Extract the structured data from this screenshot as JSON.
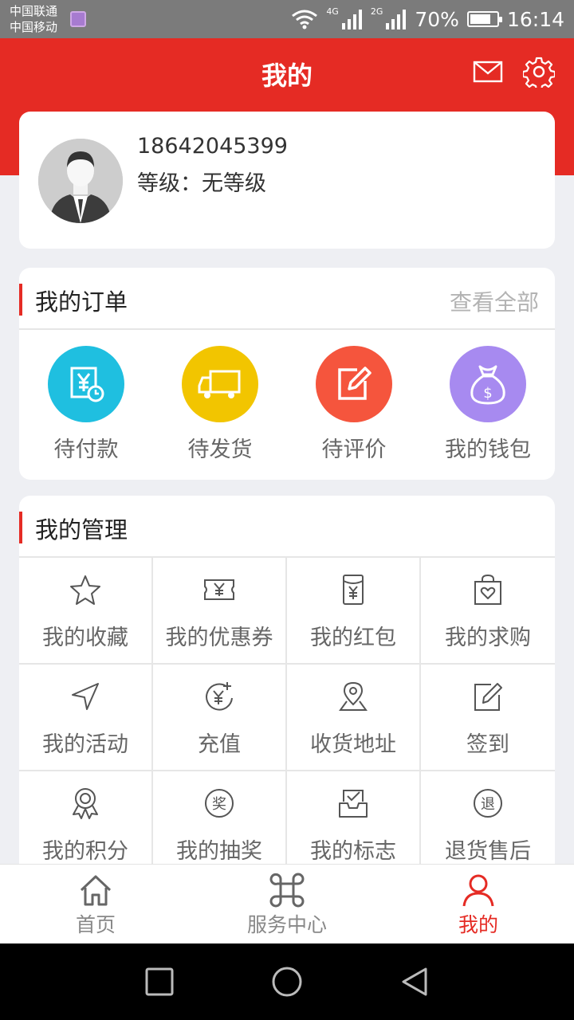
{
  "status_bar": {
    "carrier1": "中国联通",
    "carrier2": "中国移动",
    "net1": "4G",
    "net2": "2G",
    "battery": "70%",
    "time": "16:14"
  },
  "header": {
    "title": "我的"
  },
  "profile": {
    "phone": "18642045399",
    "level_label": "等级：",
    "level_value": "无等级"
  },
  "orders": {
    "title": "我的订单",
    "see_all": "查看全部",
    "items": [
      {
        "label": "待付款",
        "icon": "yen-clock-icon",
        "color": "#1fbfe0"
      },
      {
        "label": "待发货",
        "icon": "truck-icon",
        "color": "#f2c500"
      },
      {
        "label": "待评价",
        "icon": "edit-icon",
        "color": "#f5553d"
      },
      {
        "label": "我的钱包",
        "icon": "money-bag-icon",
        "color": "#a78af0"
      }
    ]
  },
  "manage": {
    "title": "我的管理",
    "items": [
      {
        "label": "我的收藏",
        "icon": "star-icon"
      },
      {
        "label": "我的优惠券",
        "icon": "coupon-icon"
      },
      {
        "label": "我的红包",
        "icon": "red-envelope-icon"
      },
      {
        "label": "我的求购",
        "icon": "shopping-bag-icon"
      },
      {
        "label": "我的活动",
        "icon": "navigation-icon"
      },
      {
        "label": "充值",
        "icon": "recharge-icon"
      },
      {
        "label": "收货地址",
        "icon": "location-icon"
      },
      {
        "label": "签到",
        "icon": "check-in-icon"
      },
      {
        "label": "我的积分",
        "icon": "medal-icon"
      },
      {
        "label": "我的抽奖",
        "icon": "prize-icon"
      },
      {
        "label": "我的标志",
        "icon": "inbox-check-icon"
      },
      {
        "label": "退货售后",
        "icon": "return-icon"
      }
    ]
  },
  "tabbar": {
    "items": [
      {
        "label": "首页",
        "icon": "home-icon"
      },
      {
        "label": "服务中心",
        "icon": "service-grid-icon"
      },
      {
        "label": "我的",
        "icon": "user-icon"
      }
    ],
    "active_index": 2
  },
  "colors": {
    "brand": "#e52b24",
    "background": "#eeeff3"
  }
}
